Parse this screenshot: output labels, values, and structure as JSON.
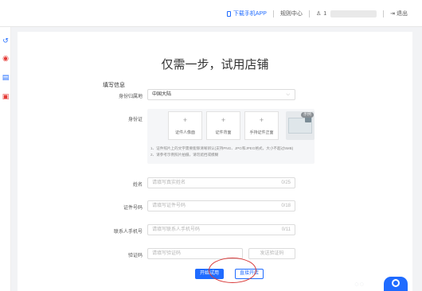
{
  "topbar": {
    "download_app": "下载手机APP",
    "rules_center": "规则中心",
    "user_initial": "1",
    "logout": "退出"
  },
  "page": {
    "title": "仅需一步，试用店铺",
    "section": "填写信息"
  },
  "form": {
    "id_region": {
      "label": "身份归属地",
      "value": "中国大陆"
    },
    "id_card": {
      "label": "身份证",
      "uploads": [
        "证件人像面",
        "证件背面",
        "手持证件正面"
      ],
      "sample_badge": "示例",
      "note_1": "1、证件照片上的文字需要能够清晰辨认(支持PNG、JPG和JPEG格式，大小不超过5MB)",
      "note_2": "2、请参考示例照片拍摄，请勿遮挡或模糊"
    },
    "name": {
      "label": "姓名",
      "placeholder": "请填写真实姓名",
      "count": "0/25"
    },
    "id_number": {
      "label": "证件号码",
      "placeholder": "请填写证件号码",
      "count": "0/18"
    },
    "phone": {
      "label": "联系人手机号",
      "placeholder": "请填写联系人手机号码",
      "count": "0/11"
    },
    "code": {
      "label": "验证码",
      "placeholder": "请填写验证码",
      "send_button": "发送验证码"
    }
  },
  "buttons": {
    "start_trial": "开始试用",
    "open_shop": "直接开店"
  },
  "colors": {
    "accent": "#1f6bff",
    "annotation": "#d83a3a"
  }
}
